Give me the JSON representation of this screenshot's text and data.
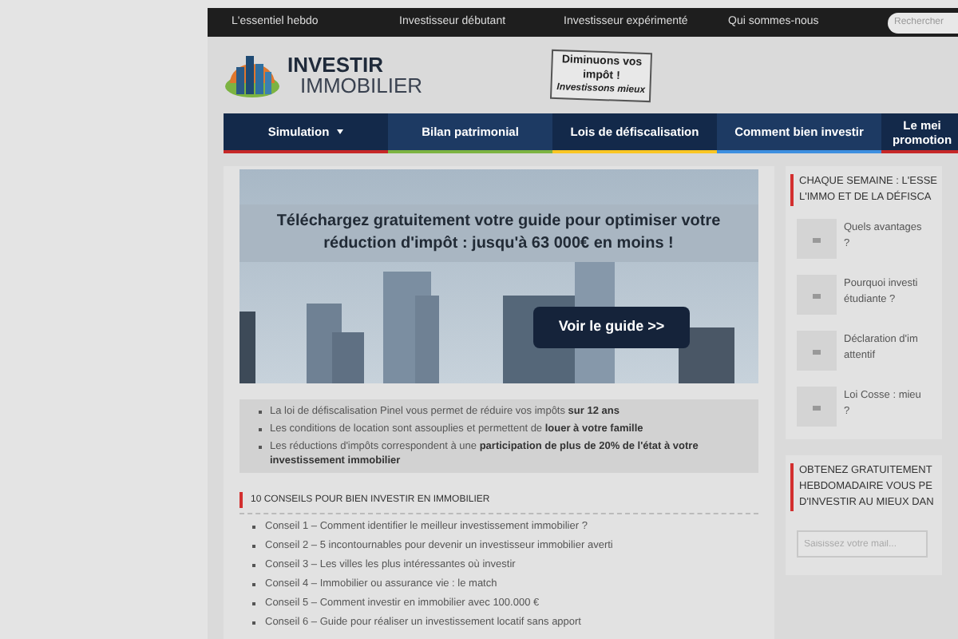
{
  "top_nav": {
    "links": [
      "L'essentiel hebdo",
      "Investisseur débutant",
      "Investisseur expérimenté",
      "Qui sommes-nous"
    ],
    "search": {
      "placeholder": "Rechercher"
    }
  },
  "logo": {
    "line1": "INVESTIR",
    "line2": "IMMOBILIER"
  },
  "sign": {
    "lines": [
      "Diminuons vos",
      "impôt !",
      "Investissons mieux"
    ]
  },
  "main_nav": [
    {
      "lines": [
        "Simulation"
      ],
      "dropdown": true,
      "color": "#c62828"
    },
    {
      "lines": [
        "Bilan patrimonial"
      ],
      "dropdown": false,
      "color": "#7cb342"
    },
    {
      "lines": [
        "Lois de défiscalisation"
      ],
      "dropdown": false,
      "color": "#f9c623"
    },
    {
      "lines": [
        "Comment bien investir"
      ],
      "dropdown": false,
      "color": "#3d8fe0"
    },
    {
      "lines": [
        "Le mei",
        "promotion"
      ],
      "dropdown": false,
      "color": "#c62828"
    }
  ],
  "hero": {
    "headline": "Téléchargez gratuitement votre guide pour optimiser votre réduction d'impôt : jusqu'à 63 000€ en moins !",
    "button": "Voir le guide >>"
  },
  "benefits": [
    "La loi de défiscalisation Pinel vous permet de réduire vos impôts **sur 12 ans**",
    "Les conditions de location sont assouplies et permettent de **louer à votre famille**",
    "Les réductions d'impôts correspondent à une **participation de plus de 20% de l'état à votre investissement immobilier**"
  ],
  "tips": {
    "title": "10 CONSEILS POUR BIEN INVESTIR EN IMMOBILIER",
    "items": [
      "Conseil 1 – Comment identifier le meilleur investissement immobilier ?",
      "Conseil 2 – 5 incontournables pour devenir un investisseur immobilier averti",
      "Conseil 3 – Les villes les plus intéressantes où investir",
      "Conseil 4 – Immobilier ou assurance vie : le match",
      "Conseil 5 – Comment investir en immobilier avec 100.000 €",
      "Conseil 6 – Guide pour réaliser un investissement locatif sans apport"
    ]
  },
  "sidebar": {
    "weekly": {
      "title_lines": [
        "CHAQUE SEMAINE : L'ESSE",
        "L'IMMO ET DE LA DÉFISCA"
      ],
      "posts": [
        {
          "lines": [
            "Quels avantages",
            "?"
          ]
        },
        {
          "lines": [
            "Pourquoi investi",
            "étudiante ?"
          ]
        },
        {
          "lines": [
            "Déclaration d'im",
            "attentif"
          ]
        },
        {
          "lines": [
            "Loi Cosse : mieu",
            "?"
          ]
        }
      ]
    },
    "newsletter": {
      "title_lines": [
        "OBTENEZ GRATUITEMENT",
        "HEBDOMADAIRE VOUS PE",
        "D'INVESTIR AU MIEUX DAN"
      ],
      "placeholder": "Saisissez votre mail..."
    }
  }
}
